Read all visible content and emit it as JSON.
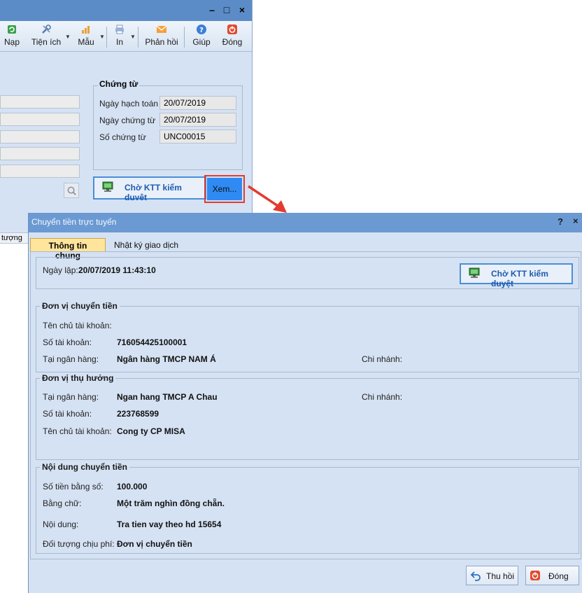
{
  "background_window": {
    "toolbar": {
      "nap": "Nạp",
      "tien_ich": "Tiện ích",
      "mau": "Mẫu",
      "in": "In",
      "phan_hoi": "Phản hồi",
      "giup": "Giúp",
      "dong": "Đóng"
    },
    "chung_tu": {
      "title": "Chứng từ",
      "ngay_hach_toan_label": "Ngày hạch toán",
      "ngay_hach_toan": "20/07/2019",
      "ngay_chung_tu_label": "Ngày chứng từ",
      "ngay_chung_tu": "20/07/2019",
      "so_chung_tu_label": "Số chứng từ",
      "so_chung_tu": "UNC00015"
    },
    "status_button": "Chờ KTT kiểm duyệt",
    "xem_button": "Xem...",
    "column_fragment": "tượng"
  },
  "dialog": {
    "title": "Chuyển tiền trực tuyến",
    "help": "?",
    "close": "×",
    "tabs": [
      "Thông tin chung",
      "Nhật ký giao dịch"
    ],
    "ngay_lap_label": "Ngày lập:",
    "ngay_lap": "20/07/2019 11:43:10",
    "status_button": "Chờ KTT kiểm duyệt",
    "don_vi_chuyen_tien": {
      "title": "Đơn vị chuyển tiền",
      "ten_chu_tk_label": "Tên chủ tài khoản:",
      "ten_chu_tk": "",
      "so_tk_label": "Số tài khoản:",
      "so_tk": "716054425100001",
      "ngan_hang_label": "Tại ngân hàng:",
      "ngan_hang": "Ngân hàng TMCP NAM Á",
      "chi_nhanh_label": "Chi nhánh:"
    },
    "don_vi_thu_huong": {
      "title": "Đơn vị thụ hưởng",
      "ngan_hang_label": "Tại ngân hàng:",
      "ngan_hang": "Ngan hang TMCP A Chau",
      "chi_nhanh_label": "Chi nhánh:",
      "so_tk_label": "Số tài khoản:",
      "so_tk": "223768599",
      "ten_chu_tk_label": "Tên chủ tài khoản:",
      "ten_chu_tk": "Cong ty CP MISA"
    },
    "noi_dung_chuyen_tien": {
      "title": "Nội dung chuyển tiền",
      "so_tien_label": "Số tiền bằng số:",
      "so_tien": "100.000",
      "bang_chu_label": "Bằng chữ:",
      "bang_chu": "Một trăm nghìn đồng chẵn.",
      "noi_dung_label": "Nội dung:",
      "noi_dung": "Tra tien vay theo hd 15654",
      "doi_tuong_label": "Đối tượng chịu phí:",
      "doi_tuong": "Đơn vị chuyển tiền"
    },
    "footer": {
      "thu_hoi": "Thu hồi",
      "dong": "Đóng"
    }
  },
  "colors": {
    "window_bg": "#d5e2f3",
    "title_bar": "#6b9ad3",
    "accent_blue": "#4a8ed8",
    "highlight_red": "#e23b2e",
    "active_tab": "#ffe59c"
  }
}
